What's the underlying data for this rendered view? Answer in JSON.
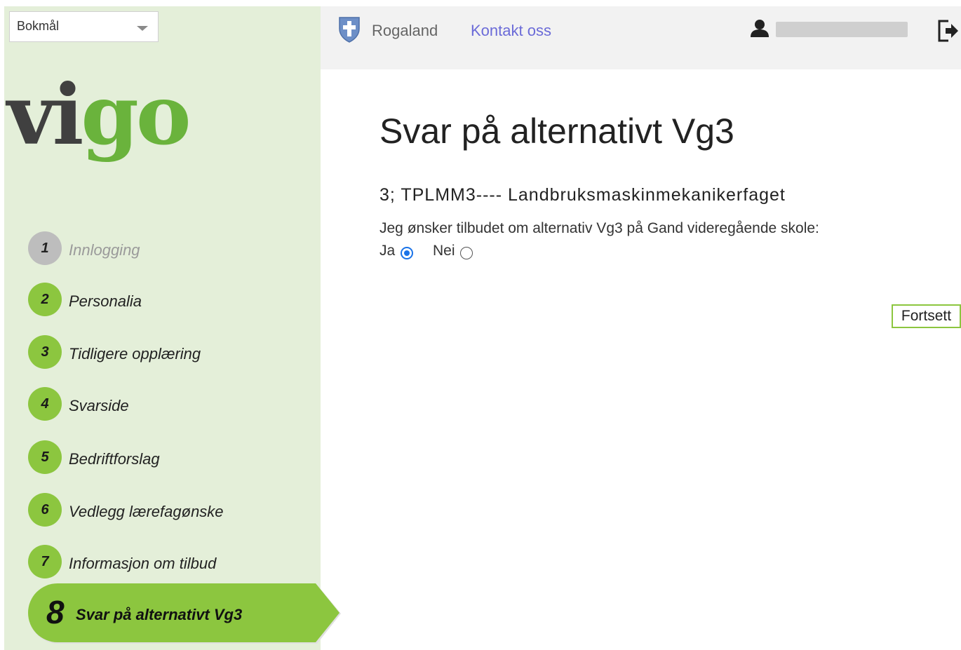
{
  "language_select": {
    "value": "Bokmål"
  },
  "logo": {
    "part1": "vi",
    "part2": "go",
    "dark_color": "#404040",
    "green_color": "#6ab33c"
  },
  "topbar": {
    "crest_icon": "county-crest-icon",
    "county": "Rogaland",
    "contact": "Kontakt oss",
    "user_icon": "user-icon",
    "logout_icon": "logout-icon"
  },
  "steps": [
    {
      "number": "1",
      "label": "Innlogging",
      "state": "done"
    },
    {
      "number": "2",
      "label": "Personalia",
      "state": "pending"
    },
    {
      "number": "3",
      "label": "Tidligere opplæring",
      "state": "pending"
    },
    {
      "number": "4",
      "label": "Svarside",
      "state": "pending"
    },
    {
      "number": "5",
      "label": "Bedriftforslag",
      "state": "pending"
    },
    {
      "number": "6",
      "label": "Vedlegg lærefagønske",
      "state": "pending"
    },
    {
      "number": "7",
      "label": "Informasjon om tilbud",
      "state": "pending"
    }
  ],
  "active_step": {
    "number": "8",
    "label": "Svar på alternativt Vg3"
  },
  "main": {
    "title": "Svar på alternativt Vg3",
    "program": "3; TPLMM3---- Landbruksmaskinmekanikerfaget",
    "question": "Jeg ønsker tilbudet om alternativ Vg3 på Gand videregående skole:",
    "options": [
      {
        "label": "Ja",
        "selected": true
      },
      {
        "label": "Nei",
        "selected": false
      }
    ],
    "continue_label": "Fortsett"
  },
  "colors": {
    "sidebar_bg": "#e4efd9",
    "step_green": "#8cc63f",
    "step_done": "#bdbdbd",
    "link": "#6b6bd8",
    "radio_checked": "#1a73e8"
  }
}
